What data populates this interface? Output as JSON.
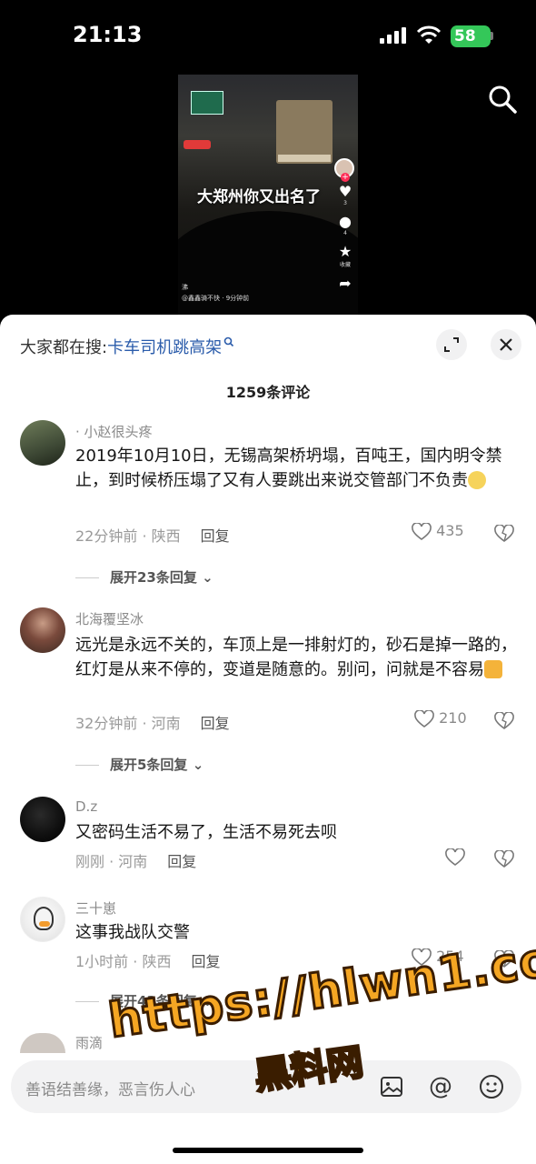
{
  "status_bar": {
    "time": "21:13",
    "battery": "58"
  },
  "video": {
    "caption": "大郑州你又出名了",
    "rail": {
      "like_count": "3",
      "comment_count": "4",
      "save_label": "收藏"
    },
    "author": "@鑫鑫骑不快",
    "posted": "9分钟前",
    "corner_label": "沸"
  },
  "sheet": {
    "search_prefix": "大家都在搜:",
    "search_keyword": "卡车司机跳高架",
    "comments_title": "1259条评论"
  },
  "comments": [
    {
      "user": "· 小赵很头疼",
      "text": "2019年10月10日，无锡高架桥坍塌，百吨王，国内明令禁止，到时候桥压塌了又有人要跳出来说交管部门不负责",
      "time_loc": "22分钟前 · 陕西",
      "reply": "回复",
      "likes": "435",
      "replies": "展开23条回复"
    },
    {
      "user": "北海覆坚冰",
      "text": "远光是永远不关的，车顶上是一排射灯的，砂石是掉一路的，红灯是从来不停的，变道是随意的。别问，问就是不容易",
      "time_loc": "32分钟前 · 河南",
      "reply": "回复",
      "likes": "210",
      "replies": "展开5条回复"
    },
    {
      "user": "D.z",
      "text": "又密码生活不易了，生活不易死去呗",
      "time_loc": "刚刚 · 河南",
      "reply": "回复",
      "likes": ""
    },
    {
      "user": "三十崽",
      "text": "这事我战队交警",
      "time_loc": "1小时前 · 陕西",
      "reply": "回复",
      "likes": "254",
      "replies": "展开43条回复"
    },
    {
      "user": "雨滴"
    }
  ],
  "input": {
    "placeholder": "善语结善缘，恶言伤人心",
    "at_symbol": "@"
  },
  "watermark": {
    "url": "https://hlwn1.com",
    "name": "黑料网"
  },
  "colors": {
    "accent_link": "#2b5cab",
    "battery": "#34c759",
    "watermark": "#f5a623"
  }
}
